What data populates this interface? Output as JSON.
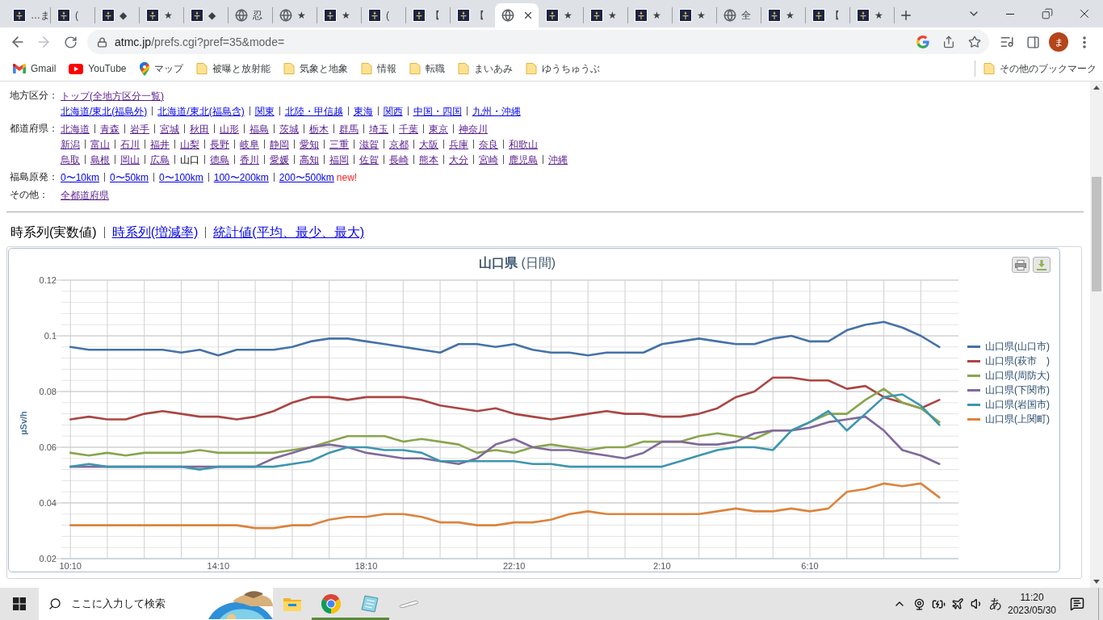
{
  "browser": {
    "tabs": [
      {
        "title": "…ま",
        "kind": "site",
        "selected": false
      },
      {
        "title": "(",
        "kind": "site",
        "selected": false
      },
      {
        "title": "◆",
        "kind": "site",
        "selected": false
      },
      {
        "title": "★",
        "kind": "site",
        "selected": false
      },
      {
        "title": "◆",
        "kind": "site",
        "selected": false
      },
      {
        "title": "忍",
        "kind": "globe",
        "selected": false
      },
      {
        "title": "★",
        "kind": "globe",
        "selected": false
      },
      {
        "title": "★",
        "kind": "site",
        "selected": false
      },
      {
        "title": "(",
        "kind": "site",
        "selected": false
      },
      {
        "title": "【",
        "kind": "site",
        "selected": false
      },
      {
        "title": "【",
        "kind": "site",
        "selected": false
      },
      {
        "kind": "globe",
        "selected": true
      },
      {
        "title": "★",
        "kind": "site",
        "selected": false
      },
      {
        "title": "★",
        "kind": "site",
        "selected": false
      },
      {
        "title": "★",
        "kind": "site",
        "selected": false
      },
      {
        "title": "★",
        "kind": "site",
        "selected": false
      },
      {
        "title": "全",
        "kind": "globe",
        "selected": false
      },
      {
        "title": "★",
        "kind": "site",
        "selected": false
      },
      {
        "title": "【",
        "kind": "site",
        "selected": false
      },
      {
        "title": "★",
        "kind": "site",
        "selected": false
      }
    ],
    "address_bar": {
      "host": "atmc.jp",
      "path": "/prefs.cgi?pref=35&mode="
    },
    "profile": {
      "initial": "ま"
    },
    "bookmarks": [
      {
        "label": "Gmail",
        "kind": "gmail"
      },
      {
        "label": "YouTube",
        "kind": "youtube"
      },
      {
        "label": "マップ",
        "kind": "maps"
      },
      {
        "label": "被曝と放射能",
        "kind": "folder"
      },
      {
        "label": "気象と地象",
        "kind": "folder"
      },
      {
        "label": "情報",
        "kind": "folder"
      },
      {
        "label": "転職",
        "kind": "folder"
      },
      {
        "label": "まいあみ",
        "kind": "folder"
      },
      {
        "label": "ゆうちゅうぶ",
        "kind": "folder"
      }
    ],
    "other_bookmarks": "その他のブックマーク"
  },
  "page": {
    "nav": [
      {
        "label": "地方区分：",
        "lines": [
          [
            {
              "text": "トップ(全地方区分一覧)",
              "kind": "link",
              "visited": true
            }
          ],
          [
            {
              "text": "北海道/東北(福島外)",
              "kind": "link",
              "visited": false
            },
            {
              "text": "北海道/東北(福島含)",
              "kind": "link",
              "visited": false
            },
            {
              "text": "関東",
              "kind": "link",
              "visited": false
            },
            {
              "text": "北陸・甲信越",
              "kind": "link",
              "visited": false
            },
            {
              "text": "東海",
              "kind": "link",
              "visited": false
            },
            {
              "text": "関西",
              "kind": "link",
              "visited": false
            },
            {
              "text": "中国・四国",
              "kind": "link",
              "visited": false
            },
            {
              "text": "九州・沖縄",
              "kind": "link",
              "visited": false
            }
          ]
        ]
      },
      {
        "label": "都道府県：",
        "lines": [
          [
            {
              "text": "北海道",
              "kind": "link",
              "visited": true
            },
            {
              "text": "青森",
              "kind": "link",
              "visited": true
            },
            {
              "text": "岩手",
              "kind": "link",
              "visited": true
            },
            {
              "text": "宮城",
              "kind": "link",
              "visited": true
            },
            {
              "text": "秋田",
              "kind": "link",
              "visited": true
            },
            {
              "text": "山形",
              "kind": "link",
              "visited": true
            },
            {
              "text": "福島",
              "kind": "link",
              "visited": true
            },
            {
              "text": "茨城",
              "kind": "link",
              "visited": true
            },
            {
              "text": "栃木",
              "kind": "link",
              "visited": true
            },
            {
              "text": "群馬",
              "kind": "link",
              "visited": true
            },
            {
              "text": "埼玉",
              "kind": "link",
              "visited": true
            },
            {
              "text": "千葉",
              "kind": "link",
              "visited": true
            },
            {
              "text": "東京",
              "kind": "link",
              "visited": true
            },
            {
              "text": "神奈川",
              "kind": "link",
              "visited": true
            }
          ],
          [
            {
              "text": "新潟",
              "kind": "link",
              "visited": true
            },
            {
              "text": "富山",
              "kind": "link",
              "visited": true
            },
            {
              "text": "石川",
              "kind": "link",
              "visited": true
            },
            {
              "text": "福井",
              "kind": "link",
              "visited": true
            },
            {
              "text": "山梨",
              "kind": "link",
              "visited": true
            },
            {
              "text": "長野",
              "kind": "link",
              "visited": true
            },
            {
              "text": "岐阜",
              "kind": "link",
              "visited": true
            },
            {
              "text": "静岡",
              "kind": "link",
              "visited": true
            },
            {
              "text": "愛知",
              "kind": "link",
              "visited": true
            },
            {
              "text": "三重",
              "kind": "link",
              "visited": true
            },
            {
              "text": "滋賀",
              "kind": "link",
              "visited": true
            },
            {
              "text": "京都",
              "kind": "link",
              "visited": true
            },
            {
              "text": "大阪",
              "kind": "link",
              "visited": true
            },
            {
              "text": "兵庫",
              "kind": "link",
              "visited": true
            },
            {
              "text": "奈良",
              "kind": "link",
              "visited": true
            },
            {
              "text": "和歌山",
              "kind": "link",
              "visited": true
            }
          ],
          [
            {
              "text": "鳥取",
              "kind": "link",
              "visited": true
            },
            {
              "text": "島根",
              "kind": "link",
              "visited": true
            },
            {
              "text": "岡山",
              "kind": "link",
              "visited": true
            },
            {
              "text": "広島",
              "kind": "link",
              "visited": true
            },
            {
              "text": "山口",
              "kind": "current"
            },
            {
              "text": "徳島",
              "kind": "link",
              "visited": true
            },
            {
              "text": "香川",
              "kind": "link",
              "visited": true
            },
            {
              "text": "愛媛",
              "kind": "link",
              "visited": true
            },
            {
              "text": "高知",
              "kind": "link",
              "visited": true
            },
            {
              "text": "福岡",
              "kind": "link",
              "visited": true
            },
            {
              "text": "佐賀",
              "kind": "link",
              "visited": true
            },
            {
              "text": "長崎",
              "kind": "link",
              "visited": true
            },
            {
              "text": "熊本",
              "kind": "link",
              "visited": true
            },
            {
              "text": "大分",
              "kind": "link",
              "visited": true
            },
            {
              "text": "宮崎",
              "kind": "link",
              "visited": true
            },
            {
              "text": "鹿児島",
              "kind": "link",
              "visited": true
            },
            {
              "text": "沖縄",
              "kind": "link",
              "visited": true
            }
          ]
        ]
      },
      {
        "label": "福島原発：",
        "lines": [
          [
            {
              "text": "0〜10km",
              "kind": "link",
              "visited": false
            },
            {
              "text": "0〜50km",
              "kind": "link",
              "visited": false
            },
            {
              "text": "0〜100km",
              "kind": "link",
              "visited": false
            },
            {
              "text": "100〜200km",
              "kind": "link",
              "visited": false
            },
            {
              "text": "200〜500km",
              "kind": "link",
              "visited": false
            },
            {
              "text": "new!",
              "kind": "badge"
            }
          ]
        ]
      },
      {
        "label": "その他：",
        "lines": [
          [
            {
              "text": "全都道府県",
              "kind": "link",
              "visited": true
            }
          ]
        ]
      }
    ],
    "views": [
      {
        "text": "時系列(実数値)",
        "selected": true
      },
      {
        "text": "時系列(増減率)",
        "selected": false
      },
      {
        "text": "統計値(平均、最少、最大)",
        "selected": false
      }
    ],
    "chart": {
      "chart_data": {
        "type": "line",
        "title": "**山口県** (日間)",
        "ylabel": "µSv/h",
        "grid": true,
        "legend": "right",
        "categories": [
          "10:10",
          null,
          null,
          null,
          null,
          null,
          null,
          null,
          "14:10",
          null,
          null,
          null,
          null,
          null,
          null,
          null,
          "18:10",
          null,
          null,
          null,
          null,
          null,
          null,
          null,
          "22:10",
          null,
          null,
          null,
          null,
          null,
          null,
          null,
          "2:10",
          null,
          null,
          null,
          null,
          null,
          null,
          null,
          "6:10",
          null,
          null,
          null,
          null,
          null,
          null,
          null
        ],
        "ylim": [
          0.02,
          0.12
        ],
        "yticks": [
          0.02,
          0.04,
          0.06,
          0.08,
          0.1,
          0.12
        ],
        "series": [
          {
            "name": "山口県(山口市)",
            "color": "#4572a7",
            "values": [
              0.096,
              0.095,
              0.095,
              0.095,
              0.095,
              0.095,
              0.094,
              0.095,
              0.093,
              0.095,
              0.095,
              0.095,
              0.096,
              0.098,
              0.099,
              0.099,
              0.098,
              0.097,
              0.096,
              0.095,
              0.094,
              0.097,
              0.097,
              0.096,
              0.097,
              0.095,
              0.094,
              0.094,
              0.093,
              0.094,
              0.094,
              0.094,
              0.097,
              0.098,
              0.099,
              0.098,
              0.097,
              0.097,
              0.099,
              0.1,
              0.098,
              0.098,
              0.102,
              0.104,
              0.105,
              0.103,
              0.1,
              0.096
            ]
          },
          {
            "name": "山口県(萩市　)",
            "color": "#aa4643",
            "values": [
              0.07,
              0.071,
              0.07,
              0.07,
              0.072,
              0.073,
              0.072,
              0.071,
              0.071,
              0.07,
              0.071,
              0.073,
              0.076,
              0.078,
              0.078,
              0.077,
              0.078,
              0.078,
              0.078,
              0.077,
              0.075,
              0.074,
              0.073,
              0.074,
              0.072,
              0.071,
              0.07,
              0.071,
              0.072,
              0.073,
              0.072,
              0.072,
              0.071,
              0.071,
              0.072,
              0.074,
              0.078,
              0.08,
              0.085,
              0.085,
              0.084,
              0.084,
              0.081,
              0.082,
              0.078,
              0.076,
              0.074,
              0.077
            ]
          },
          {
            "name": "山口県(周防大)",
            "color": "#89a54e",
            "values": [
              0.058,
              0.057,
              0.058,
              0.057,
              0.058,
              0.058,
              0.058,
              0.059,
              0.058,
              0.058,
              0.058,
              0.058,
              0.059,
              0.06,
              0.062,
              0.064,
              0.064,
              0.064,
              0.062,
              0.063,
              0.062,
              0.061,
              0.058,
              0.059,
              0.058,
              0.06,
              0.061,
              0.06,
              0.059,
              0.06,
              0.06,
              0.062,
              0.062,
              0.062,
              0.064,
              0.065,
              0.064,
              0.063,
              0.066,
              0.066,
              0.069,
              0.072,
              0.072,
              0.077,
              0.081,
              0.076,
              0.074,
              0.069
            ]
          },
          {
            "name": "山口県(下関市)",
            "color": "#80699b",
            "values": [
              0.053,
              0.053,
              0.053,
              0.053,
              0.053,
              0.053,
              0.053,
              0.053,
              0.053,
              0.053,
              0.053,
              0.056,
              0.058,
              0.06,
              0.061,
              0.06,
              0.058,
              0.057,
              0.056,
              0.056,
              0.055,
              0.054,
              0.056,
              0.061,
              0.063,
              0.06,
              0.059,
              0.059,
              0.058,
              0.057,
              0.056,
              0.058,
              0.062,
              0.062,
              0.061,
              0.061,
              0.062,
              0.065,
              0.066,
              0.066,
              0.067,
              0.069,
              0.07,
              0.071,
              0.066,
              0.059,
              0.057,
              0.054
            ]
          },
          {
            "name": "山口県(岩国市)",
            "color": "#3d96ae",
            "values": [
              0.053,
              0.054,
              0.053,
              0.053,
              0.053,
              0.053,
              0.053,
              0.052,
              0.053,
              0.053,
              0.053,
              0.053,
              0.054,
              0.055,
              0.058,
              0.06,
              0.06,
              0.059,
              0.059,
              0.058,
              0.055,
              0.055,
              0.055,
              0.055,
              0.055,
              0.054,
              0.054,
              0.053,
              0.053,
              0.053,
              0.053,
              0.053,
              0.053,
              0.055,
              0.057,
              0.059,
              0.06,
              0.06,
              0.059,
              0.066,
              0.069,
              0.073,
              0.066,
              0.072,
              0.078,
              0.079,
              0.075,
              0.068
            ]
          },
          {
            "name": "山口県(上関町)",
            "color": "#db843d",
            "values": [
              0.032,
              0.032,
              0.032,
              0.032,
              0.032,
              0.032,
              0.032,
              0.032,
              0.032,
              0.032,
              0.031,
              0.031,
              0.032,
              0.032,
              0.034,
              0.035,
              0.035,
              0.036,
              0.036,
              0.035,
              0.033,
              0.033,
              0.032,
              0.032,
              0.033,
              0.033,
              0.034,
              0.036,
              0.037,
              0.036,
              0.036,
              0.036,
              0.036,
              0.036,
              0.036,
              0.037,
              0.038,
              0.037,
              0.037,
              0.038,
              0.037,
              0.038,
              0.044,
              0.045,
              0.047,
              0.046,
              0.047,
              0.042
            ]
          }
        ]
      }
    }
  },
  "taskbar": {
    "search": {
      "placeholder": "ここに入力して検索"
    },
    "apps": [
      {
        "kind": "explorer",
        "running": false
      },
      {
        "kind": "chrome",
        "running": true
      },
      {
        "kind": "notes",
        "running": true
      },
      {
        "kind": "capsule",
        "running": false
      }
    ],
    "tray": {
      "ime": "あ",
      "time": "11:20",
      "date": "2023/05/30"
    }
  }
}
